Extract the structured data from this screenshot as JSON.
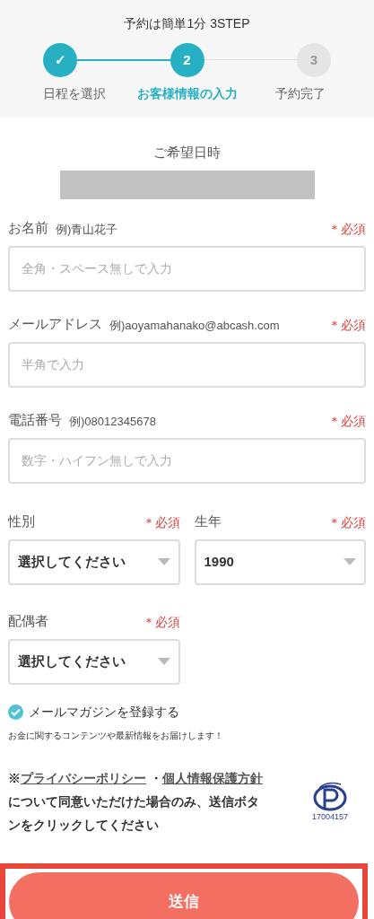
{
  "header": {
    "title": "予約は簡単1分 3STEP",
    "steps": [
      {
        "marker": "✓",
        "label": "日程を選択",
        "selected": false
      },
      {
        "marker": "2",
        "label": "お客様情報の入力",
        "selected": true
      },
      {
        "marker": "3",
        "label": "予約完了",
        "selected": false
      }
    ]
  },
  "schedule": {
    "label": "ご希望日時"
  },
  "fields": [
    {
      "label": "お名前",
      "example": "例)青山花子",
      "required": "＊必須",
      "placeholder": "全角・スペース無しで入力"
    },
    {
      "label": "メールアドレス",
      "example": "例)aoyamahanako@abcash.com",
      "required": "＊必須",
      "placeholder": "半角で入力"
    },
    {
      "label": "電話番号",
      "example": "例)08012345678",
      "required": "＊必須",
      "placeholder": "数字・ハイフン無しで入力"
    }
  ],
  "selects": [
    [
      {
        "label": "性別",
        "required": "＊必須",
        "value": "選択してください"
      },
      {
        "label": "生年",
        "required": "＊必須",
        "value": "1990"
      }
    ],
    [
      {
        "label": "配偶者",
        "required": "＊必須",
        "value": "選択してください"
      }
    ]
  ],
  "newsletter": {
    "label": "メールマガジンを登録する",
    "checked": true,
    "note": "お金に関するコンテンツや最新情報をお届けします！"
  },
  "consent": {
    "prefix": "※",
    "link1": "プライバシーポリシー",
    "separator": "・",
    "link2": "個人情報保護方針",
    "text": "について同意いただけた場合のみ、送信ボタンをクリックしてください",
    "mark_number": "17004157"
  },
  "submit": {
    "label": "送信"
  }
}
